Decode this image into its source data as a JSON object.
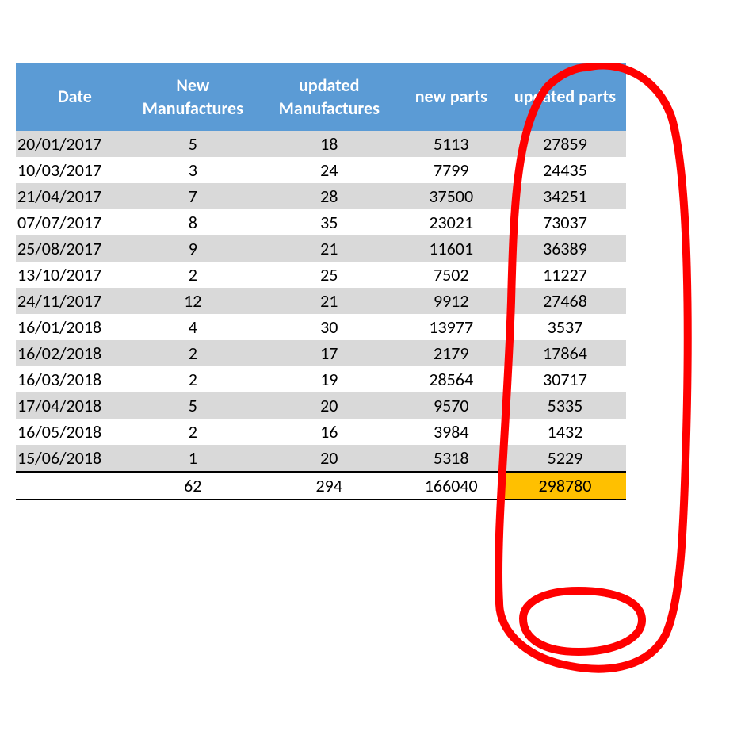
{
  "table": {
    "headers": {
      "date": "Date",
      "new_manufactures": "New Manufactures",
      "updated_manufactures": "updated Manufactures",
      "new_parts": "new parts",
      "updated_parts": "updated parts"
    },
    "rows": [
      {
        "date": "20/01/2017",
        "new_man": "5",
        "upd_man": "18",
        "new_parts": "5113",
        "upd_parts": "27859"
      },
      {
        "date": "10/03/2017",
        "new_man": "3",
        "upd_man": "24",
        "new_parts": "7799",
        "upd_parts": "24435"
      },
      {
        "date": "21/04/2017",
        "new_man": "7",
        "upd_man": "28",
        "new_parts": "37500",
        "upd_parts": "34251"
      },
      {
        "date": "07/07/2017",
        "new_man": "8",
        "upd_man": "35",
        "new_parts": "23021",
        "upd_parts": "73037"
      },
      {
        "date": "25/08/2017",
        "new_man": "9",
        "upd_man": "21",
        "new_parts": "11601",
        "upd_parts": "36389"
      },
      {
        "date": "13/10/2017",
        "new_man": "2",
        "upd_man": "25",
        "new_parts": "7502",
        "upd_parts": "11227"
      },
      {
        "date": "24/11/2017",
        "new_man": "12",
        "upd_man": "21",
        "new_parts": "9912",
        "upd_parts": "27468"
      },
      {
        "date": "16/01/2018",
        "new_man": "4",
        "upd_man": "30",
        "new_parts": "13977",
        "upd_parts": "3537"
      },
      {
        "date": "16/02/2018",
        "new_man": "2",
        "upd_man": "17",
        "new_parts": "2179",
        "upd_parts": "17864"
      },
      {
        "date": "16/03/2018",
        "new_man": "2",
        "upd_man": "19",
        "new_parts": "28564",
        "upd_parts": "30717"
      },
      {
        "date": "17/04/2018",
        "new_man": "5",
        "upd_man": "20",
        "new_parts": "9570",
        "upd_parts": "5335"
      },
      {
        "date": "16/05/2018",
        "new_man": "2",
        "upd_man": "16",
        "new_parts": "3984",
        "upd_parts": "1432"
      },
      {
        "date": "15/06/2018",
        "new_man": "1",
        "upd_man": "20",
        "new_parts": "5318",
        "upd_parts": "5229"
      }
    ],
    "totals": {
      "date": "",
      "new_man": "62",
      "upd_man": "294",
      "new_parts": "166040",
      "upd_parts": "298780"
    }
  },
  "colors": {
    "header_bg": "#5b9bd5",
    "row_odd": "#d9d9d9",
    "row_even": "#ffffff",
    "highlight": "#ffc000",
    "annotation": "#ff0000"
  }
}
